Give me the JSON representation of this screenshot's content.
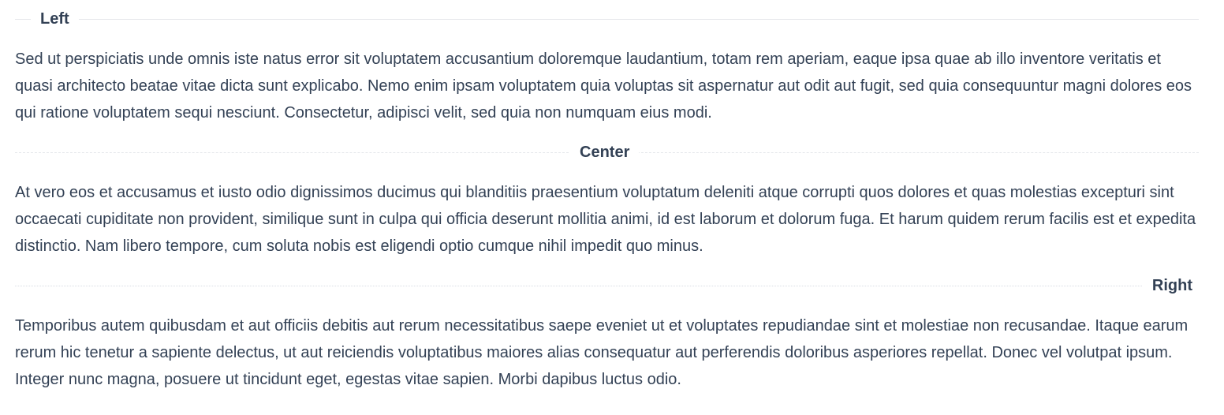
{
  "sections": [
    {
      "label": "Left",
      "text": "Sed ut perspiciatis unde omnis iste natus error sit voluptatem accusantium doloremque laudantium, totam rem aperiam, eaque ipsa quae ab illo inventore veritatis et quasi architecto beatae vitae dicta sunt explicabo. Nemo enim ipsam voluptatem quia voluptas sit aspernatur aut odit aut fugit, sed quia consequuntur magni dolores eos qui ratione voluptatem sequi nesciunt. Consectetur, adipisci velit, sed quia non numquam eius modi."
    },
    {
      "label": "Center",
      "text": "At vero eos et accusamus et iusto odio dignissimos ducimus qui blanditiis praesentium voluptatum deleniti atque corrupti quos dolores et quas molestias excepturi sint occaecati cupiditate non provident, similique sunt in culpa qui officia deserunt mollitia animi, id est laborum et dolorum fuga. Et harum quidem rerum facilis est et expedita distinctio. Nam libero tempore, cum soluta nobis est eligendi optio cumque nihil impedit quo minus."
    },
    {
      "label": "Right",
      "text": "Temporibus autem quibusdam et aut officiis debitis aut rerum necessitatibus saepe eveniet ut et voluptates repudiandae sint et molestiae non recusandae. Itaque earum rerum hic tenetur a sapiente delectus, ut aut reiciendis voluptatibus maiores alias consequatur aut perferendis doloribus asperiores repellat. Donec vel volutpat ipsum. Integer nunc magna, posuere ut tincidunt eget, egestas vitae sapien. Morbi dapibus luctus odio."
    }
  ]
}
